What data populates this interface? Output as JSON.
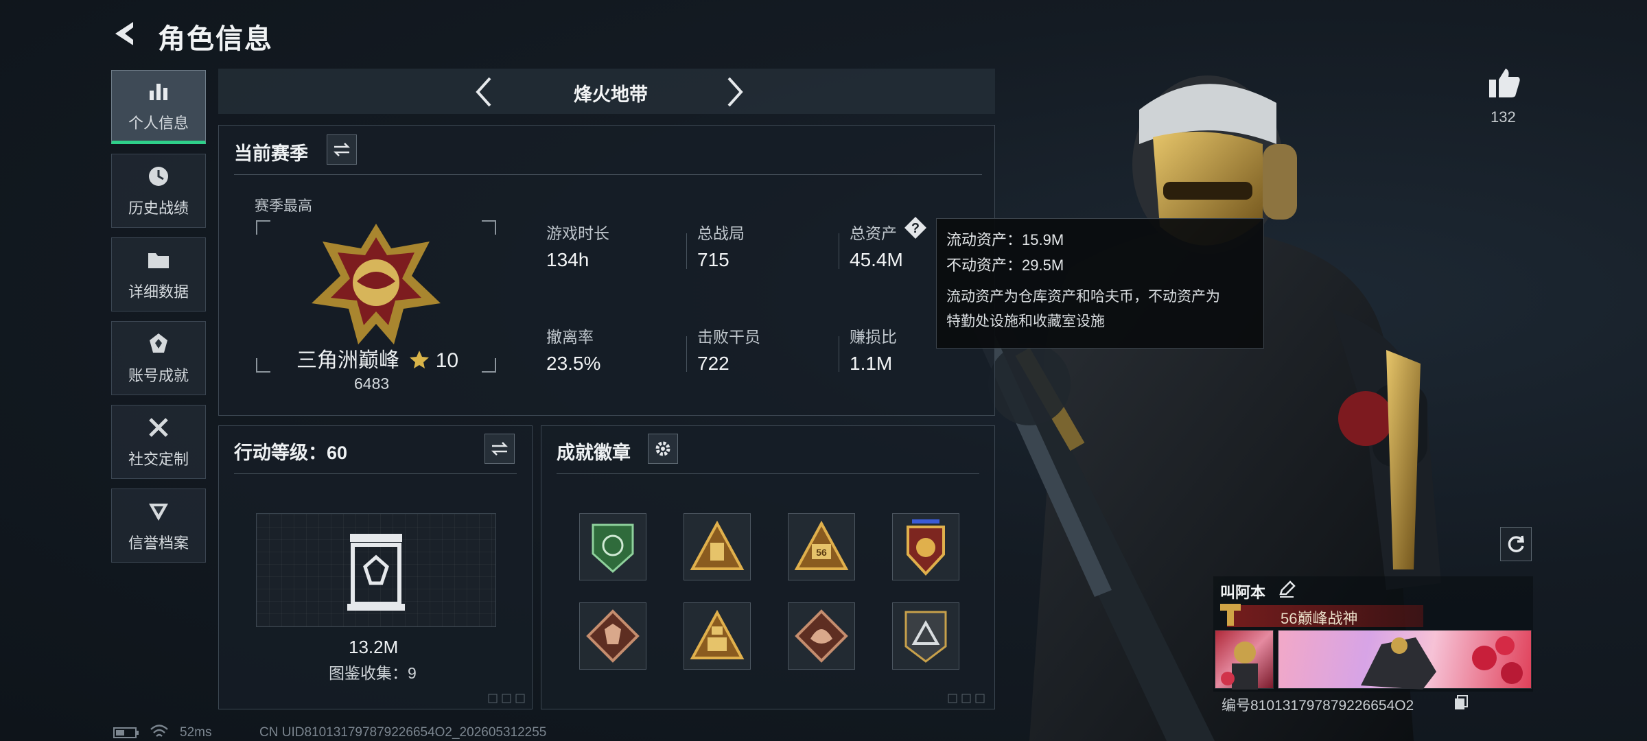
{
  "header": {
    "title": "角色信息"
  },
  "nav": {
    "items": [
      {
        "label": "个人信息",
        "icon": "bar-chart-icon",
        "active": true
      },
      {
        "label": "历史战绩",
        "icon": "clock-icon",
        "active": false
      },
      {
        "label": "详细数据",
        "icon": "folder-icon",
        "active": false
      },
      {
        "label": "账号成就",
        "icon": "achievement-icon",
        "active": false
      },
      {
        "label": "社交定制",
        "icon": "tools-icon",
        "active": false
      },
      {
        "label": "信誉档案",
        "icon": "shield-icon",
        "active": false
      }
    ]
  },
  "mode": {
    "title": "烽火地带"
  },
  "season": {
    "title": "当前赛季",
    "best_label": "赛季最高",
    "rank_name": "三角洲巅峰",
    "rank_stars": "10",
    "rank_points": "6483",
    "stats": [
      {
        "label": "游戏时长",
        "value": "134h"
      },
      {
        "label": "总战局",
        "value": "715"
      },
      {
        "label": "总资产",
        "value": "45.4M"
      },
      {
        "label": "撤离率",
        "value": "23.5%"
      },
      {
        "label": "击败干员",
        "value": "722"
      },
      {
        "label": "赚损比",
        "value": "1.1M"
      }
    ]
  },
  "tooltip": {
    "liquid": "流动资产：15.9M",
    "fixed": "不动资产：29.5M",
    "note_line1": "流动资产为仓库资产和哈夫币，不动资产为",
    "note_line2": "特勤处设施和收藏室设施"
  },
  "action_level": {
    "title": "行动等级：60",
    "value": "13.2M",
    "collection": "图鉴收集：9"
  },
  "achievements": {
    "title": "成就徽章",
    "badges": [
      "green-lion-badge-icon",
      "gold-triangle-badge-icon",
      "gold-triangle-56-badge-icon",
      "star-shield-badge-icon",
      "bronze-wolf-badge-icon",
      "gold-pyramid-badge-icon",
      "bronze-dragon-badge-icon",
      "silver-triangle-badge-icon"
    ],
    "badge56": "56"
  },
  "profile": {
    "likes": "132",
    "name": "叫阿本",
    "title_badge": "56巅峰战神",
    "player_id": "编号810131797879226654O2"
  },
  "status": {
    "ping": "52ms",
    "uid": "CN UID810131797879226654O2_202605312255"
  },
  "colors": {
    "accent_green": "#2fd08a",
    "gold": "#c9a24a",
    "title_red": "#7a1d1d"
  }
}
